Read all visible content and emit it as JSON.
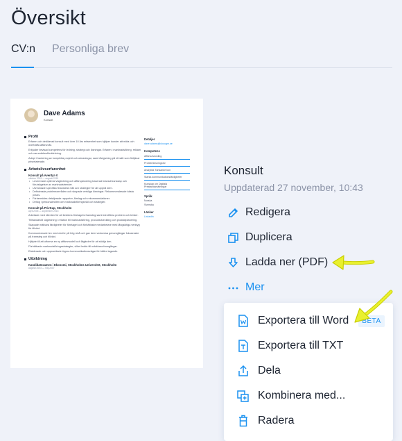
{
  "page_title": "Översikt",
  "tabs": [
    {
      "label": "CV:n",
      "active": true
    },
    {
      "label": "Personliga brev",
      "active": false
    }
  ],
  "resume_preview": {
    "name": "Dave Adams",
    "subtitle": "Konsult",
    "sections": {
      "profil": "Profil",
      "profil_text1": "Erfaren och dedikerad konsult med över 10 års erfarenhet som hjälper kunder att möta och överträffa affärsmål.",
      "profil_text2": "Erbjuder bevisad kompetens för ledning, strategi och lösningar. Erfaren i marknadsföring, reklam och varumärkesförstärkning.",
      "profil_text3": "Adept i hantering av kompletta projekt och utmaningar, samt rådgivning på ett sätt som förtjänar prisrelaterade.",
      "arbete": "Arbetslivserfarenhet",
      "job1_title": "Konsult på Aventyr-X",
      "job1_date": "oktober 2015 — augusti 2019",
      "job1_bullets": [
        "Levererade optimal vägledning och affärsplanering baserad branschkunskap och förutsägelser av marknadstrender.",
        "Utvecklade specifika finansiella mål och strategier för att uppnå dem.",
        "Definierade problemområden och skapade verkliga lösningar. Rekommenderade bästa praxis.",
        "Förbereddes detaljerade rapporter, förslag och rekommendationer.",
        "Deltog i personalmöten om marknadsföringsmål och strategier."
      ],
      "job2_title": "Konsult på PrivKap, Stockholm",
      "job2_date": "april 2005 — september 2015",
      "job2_paras": [
        "Arbetade med klienten för att bedöma företagets framsteg samt identifiera problem och brister.",
        "Tillhandahöll vägledning i relation till marknadsföring, produktutveckling och produktplanering.",
        "Skapade mätbara färdigheter för företaget och förbättrade medarbetare med långsiktiga verktyg för tillväxt.",
        "Kommunicerade tex med chefer på hög nivå och gav dem veckovisa genomgångar fokuserade på framsteg och tillväxt.",
        "Hjälpte till att utforma en ny affärsmodell och åtgärder för att stödja den.",
        "Förbättrade marknadsföringsstrategier, vilket ledde till märkbara framgångar.",
        "Etablerade och upprumtiade öppna kommunikationsvägar för bättre lagande."
      ],
      "utbildning": "Utbildning",
      "edu_title": "Kandidatexamen i Ekonomi, Stockholms Universitet, Stockholm",
      "edu_date": "augusti 2003 — maj 2007"
    },
    "side": {
      "detaljer_h": "Detaljer",
      "email": "dave.adams@ukuugm.se",
      "kompetens_h": "Kompetens",
      "skills": [
        "Affärsutveckling",
        "Problemlösningsfor",
        "Analytisk Tänkande kon",
        "Starka kommunikationsfärdigheter",
        "Kunskap om Digitala Prestandamätningar"
      ],
      "sprak_h": "Språk",
      "languages": [
        "Norska",
        "Svenska"
      ],
      "lankar_h": "Länker",
      "link": "LinkedIn"
    }
  },
  "document": {
    "name": "Konsult",
    "updated": "Uppdaterad 27 november, 10:43"
  },
  "actions": {
    "edit": "Redigera",
    "duplicate": "Duplicera",
    "download": "Ladda ner (PDF)",
    "more": "Mer"
  },
  "menu": {
    "export_word": "Exportera till Word",
    "beta": "BETA",
    "export_txt": "Exportera till TXT",
    "share": "Dela",
    "combine": "Kombinera med...",
    "delete": "Radera"
  },
  "colors": {
    "accent": "#1a91f0",
    "background": "#eff2f9",
    "text": "#1e2532",
    "muted": "#8b93a7",
    "annotation_arrow": "#e9f02e"
  }
}
